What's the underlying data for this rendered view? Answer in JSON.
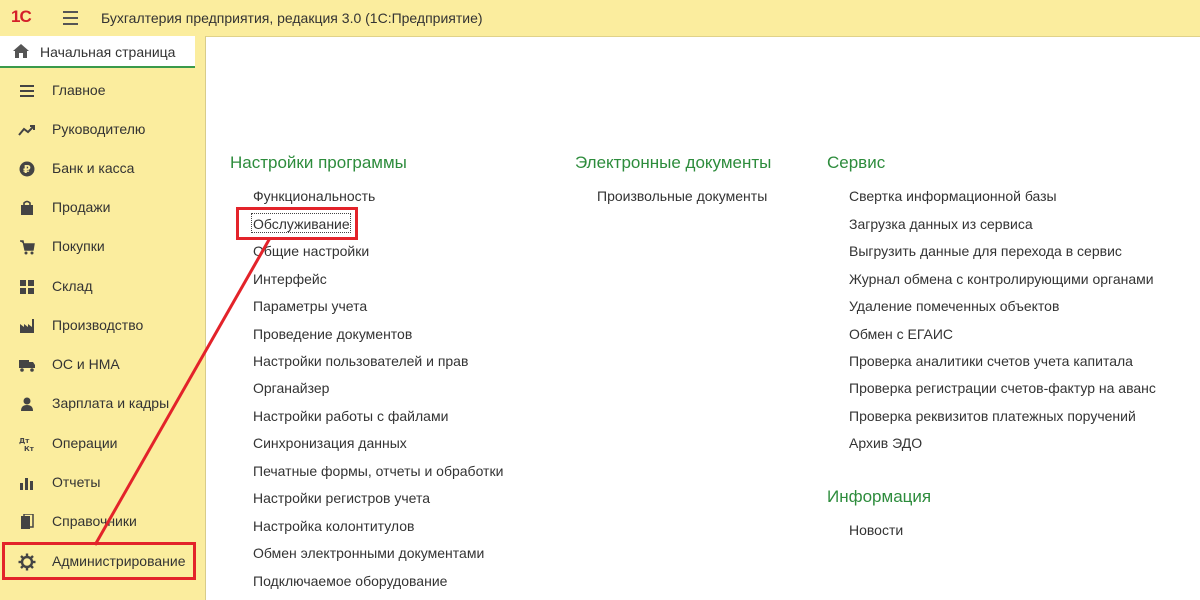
{
  "header": {
    "logo_text": "1С",
    "app_title": "Бухгалтерия предприятия, редакция 3.0  (1С:Предприятие)"
  },
  "sidebar": {
    "home_label": "Начальная страница",
    "items": [
      {
        "label": "Главное",
        "icon": "menu-lines-icon"
      },
      {
        "label": "Руководителю",
        "icon": "trend-icon"
      },
      {
        "label": "Банк и касса",
        "icon": "ruble-icon"
      },
      {
        "label": "Продажи",
        "icon": "shopping-bag-icon"
      },
      {
        "label": "Покупки",
        "icon": "cart-icon"
      },
      {
        "label": "Склад",
        "icon": "warehouse-icon"
      },
      {
        "label": "Производство",
        "icon": "factory-icon"
      },
      {
        "label": "ОС и НМА",
        "icon": "truck-icon"
      },
      {
        "label": "Зарплата и кадры",
        "icon": "person-icon"
      },
      {
        "label": "Операции",
        "icon": "dt-kt-icon"
      },
      {
        "label": "Отчеты",
        "icon": "bar-chart-icon"
      },
      {
        "label": "Справочники",
        "icon": "books-icon"
      },
      {
        "label": "Администрирование",
        "icon": "gear-icon"
      }
    ]
  },
  "main": {
    "settings": {
      "title": "Настройки программы",
      "links": [
        "Функциональность",
        "Обслуживание",
        "Общие настройки",
        "Интерфейс",
        "Параметры учета",
        "Проведение документов",
        "Настройки пользователей и прав",
        "Органайзер",
        "Настройки работы с файлами",
        "Синхронизация данных",
        "Печатные формы, отчеты и обработки",
        "Настройки регистров учета",
        "Настройка колонтитулов",
        "Обмен электронными документами",
        "Подключаемое оборудование"
      ]
    },
    "edocs": {
      "title": "Электронные документы",
      "links": [
        "Произвольные документы"
      ]
    },
    "service": {
      "title": "Сервис",
      "links": [
        "Свертка информационной базы",
        "Загрузка данных из сервиса",
        "Выгрузить данные для перехода в сервис",
        "Журнал обмена с контролирующими органами",
        "Удаление помеченных объектов",
        "Обмен с ЕГАИС",
        "Проверка аналитики счетов учета капитала",
        "Проверка регистрации счетов-фактур на аванс",
        "Проверка реквизитов платежных поручений",
        "Архив ЭДО"
      ]
    },
    "info": {
      "title": "Информация",
      "links": [
        "Новости"
      ]
    }
  },
  "colors": {
    "accent_green": "#2d8c3c",
    "highlight_red": "#e3232a",
    "bar_yellow": "#fbed9e"
  }
}
